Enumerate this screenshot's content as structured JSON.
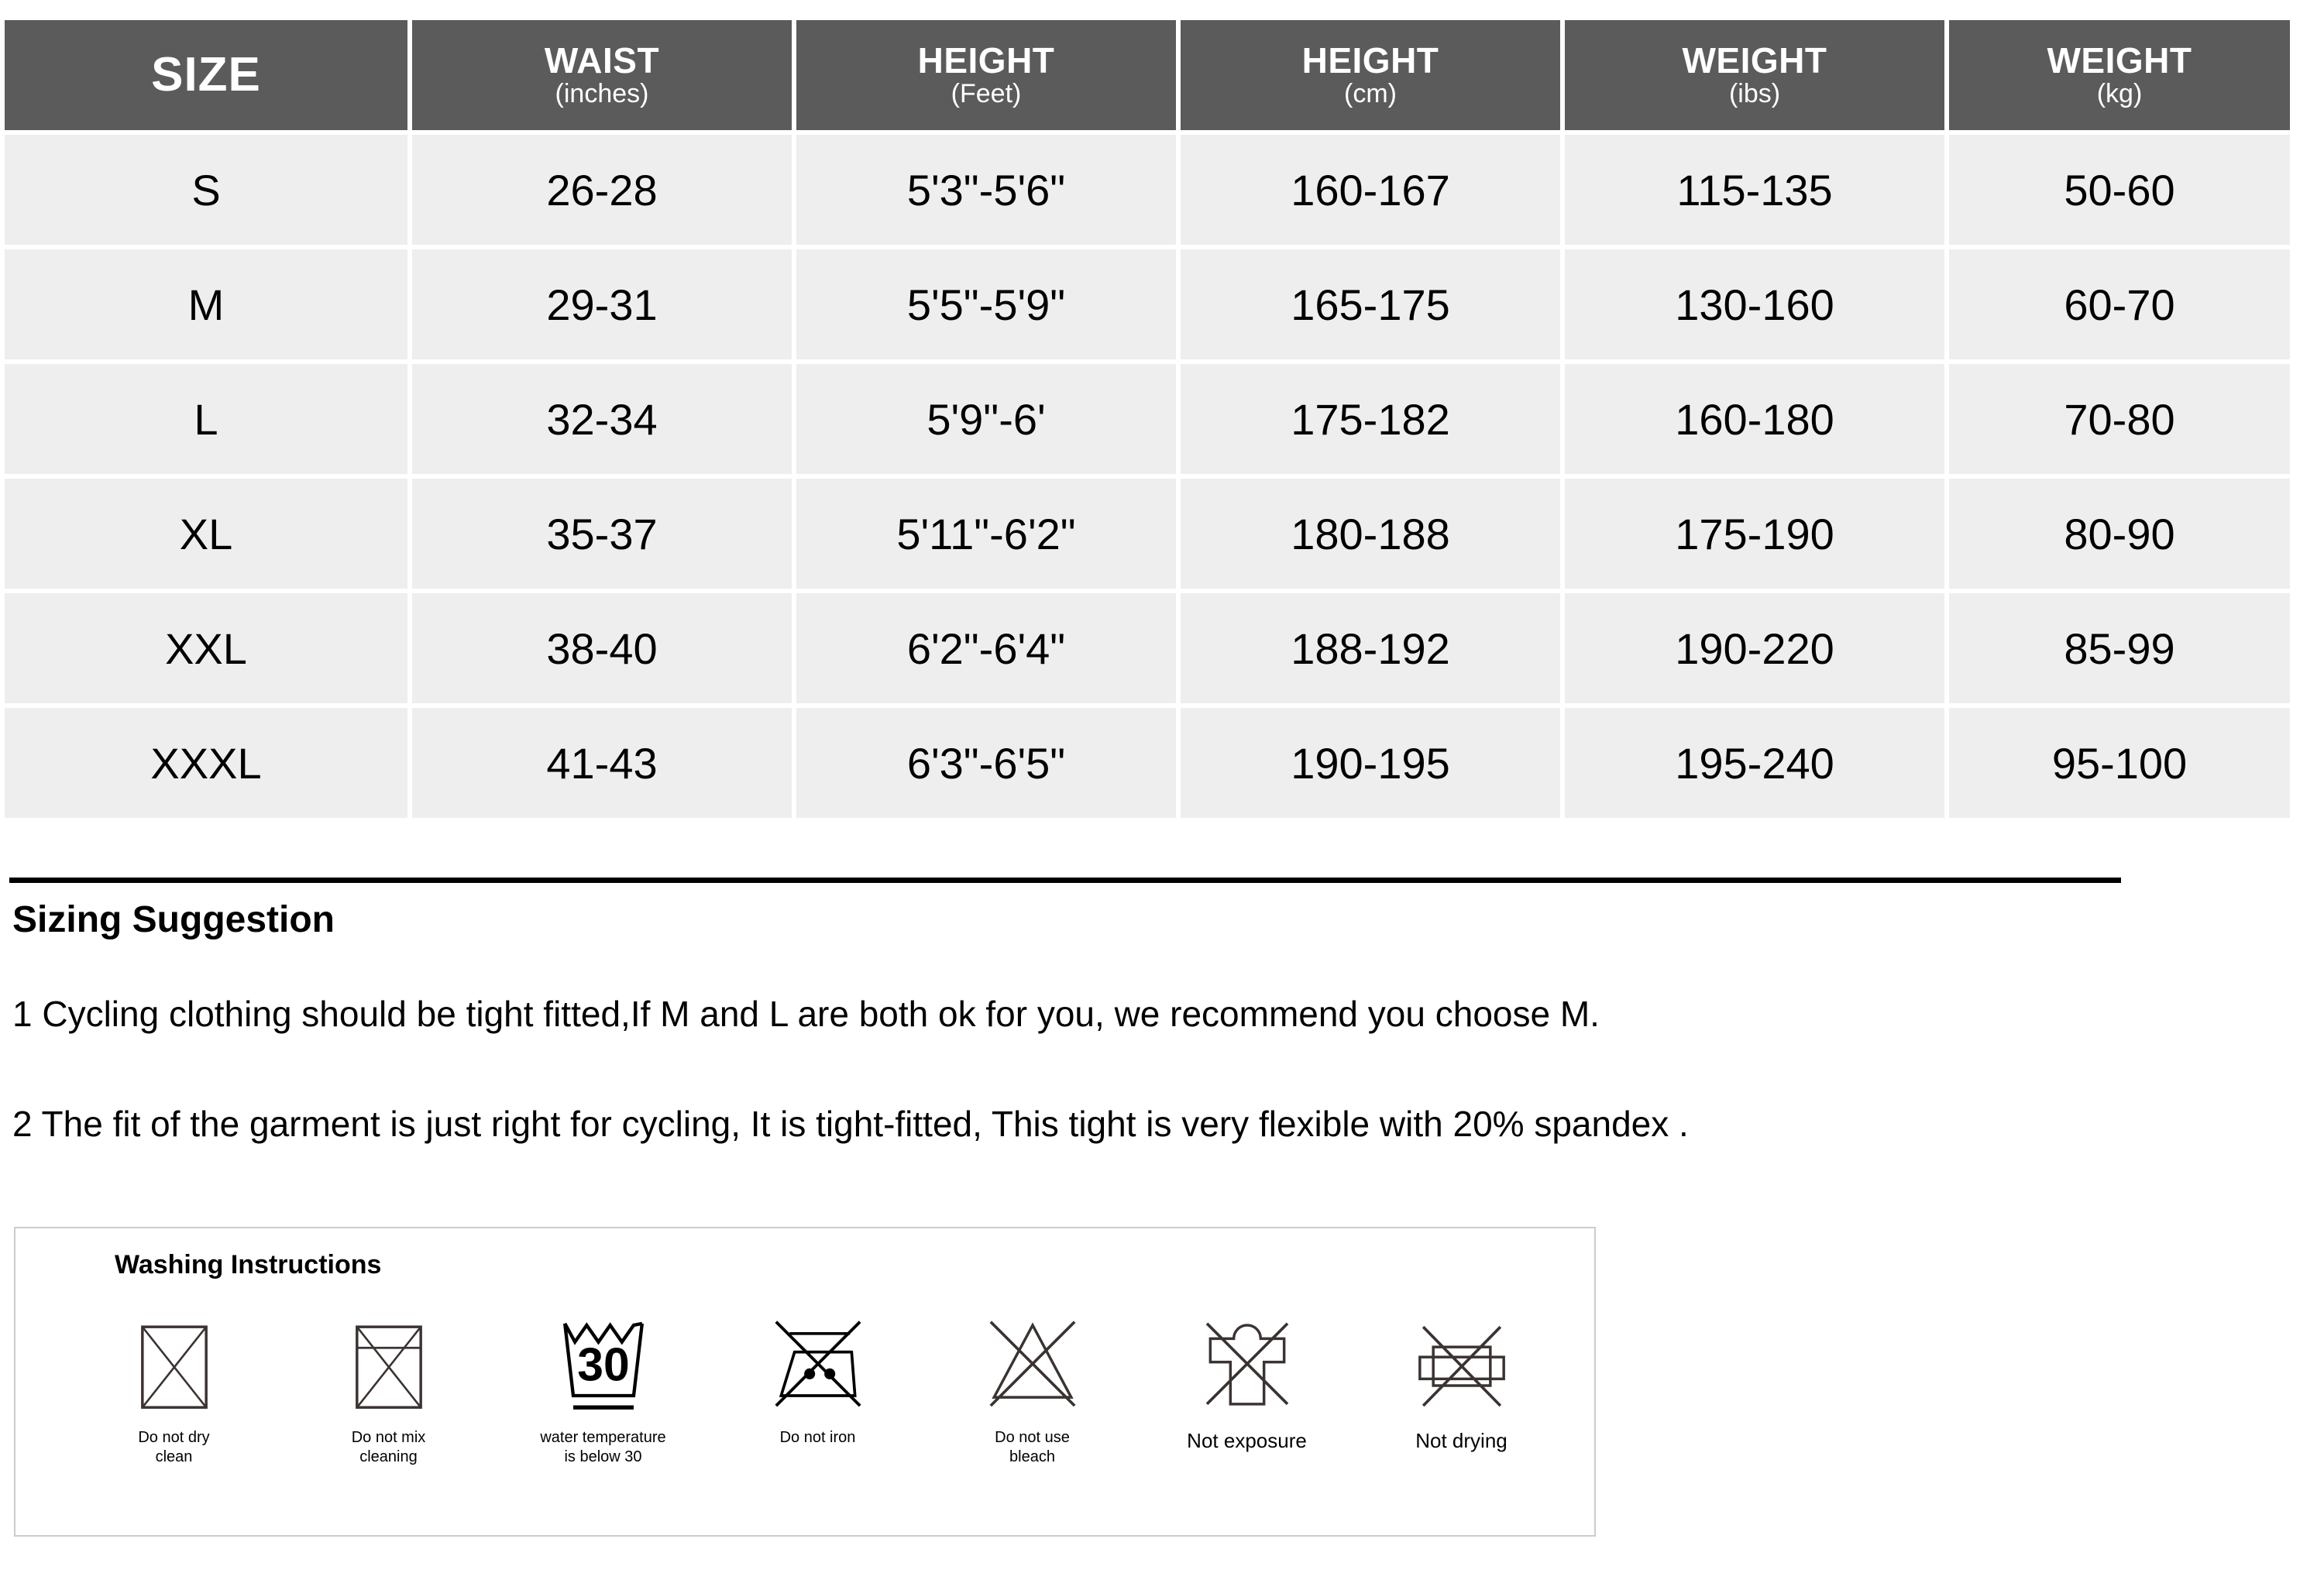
{
  "table": {
    "headers": [
      {
        "main": "SIZE",
        "sub": ""
      },
      {
        "main": "WAIST",
        "sub": "(inches)"
      },
      {
        "main": "HEIGHT",
        "sub": "(Feet)"
      },
      {
        "main": "HEIGHT",
        "sub": "(cm)"
      },
      {
        "main": "WEIGHT",
        "sub": "(ibs)"
      },
      {
        "main": "WEIGHT",
        "sub": "(kg)"
      }
    ],
    "rows": [
      {
        "size": "S",
        "waist_in": "26-28",
        "height_ft": "5'3\"-5'6\"",
        "height_cm": "160-167",
        "weight_lb": "115-135",
        "weight_kg": "50-60"
      },
      {
        "size": "M",
        "waist_in": "29-31",
        "height_ft": "5'5\"-5'9\"",
        "height_cm": "165-175",
        "weight_lb": "130-160",
        "weight_kg": "60-70"
      },
      {
        "size": "L",
        "waist_in": "32-34",
        "height_ft": "5'9\"-6'",
        "height_cm": "175-182",
        "weight_lb": "160-180",
        "weight_kg": "70-80"
      },
      {
        "size": "XL",
        "waist_in": "35-37",
        "height_ft": "5'11\"-6'2\"",
        "height_cm": "180-188",
        "weight_lb": "175-190",
        "weight_kg": "80-90"
      },
      {
        "size": "XXL",
        "waist_in": "38-40",
        "height_ft": "6'2\"-6'4\"",
        "height_cm": "188-192",
        "weight_lb": "190-220",
        "weight_kg": "85-99"
      },
      {
        "size": "XXXL",
        "waist_in": "41-43",
        "height_ft": "6'3\"-6'5\"",
        "height_cm": "190-195",
        "weight_lb": "195-240",
        "weight_kg": "95-100"
      }
    ]
  },
  "sizing": {
    "heading": "Sizing Suggestion",
    "line1": "1 Cycling clothing should be tight fitted,If M and L are both ok for you, we recommend you choose M.",
    "line2": "2 The fit of the garment is just right for cycling, It is tight-fitted, This tight is very flexible with 20% spandex ."
  },
  "washing": {
    "title": "Washing Instructions",
    "items": [
      {
        "icon": "no-dry-clean-icon",
        "label_line1": "Do not dry",
        "label_line2": "clean"
      },
      {
        "icon": "no-mix-cleaning-icon",
        "label_line1": "Do not mix",
        "label_line2": "cleaning"
      },
      {
        "icon": "wash-tub-30-icon",
        "label_line1": "water temperature",
        "label_line2": "is below 30",
        "temp": "30"
      },
      {
        "icon": "no-iron-icon",
        "label_line1": "Do not iron",
        "label_line2": ""
      },
      {
        "icon": "no-bleach-icon",
        "label_line1": "Do not use",
        "label_line2": "bleach"
      },
      {
        "icon": "no-sun-exposure-icon",
        "label_line1": "Not exposure",
        "label_line2": ""
      },
      {
        "icon": "no-tumble-dry-icon",
        "label_line1": "Not drying",
        "label_line2": ""
      }
    ]
  },
  "colors": {
    "header_bg": "#5b5b5b",
    "cell_bg": "#eeeeee",
    "header_text": "#ffffff",
    "body_text": "#000000",
    "panel_border": "#cccccc",
    "rule": "#000000"
  }
}
